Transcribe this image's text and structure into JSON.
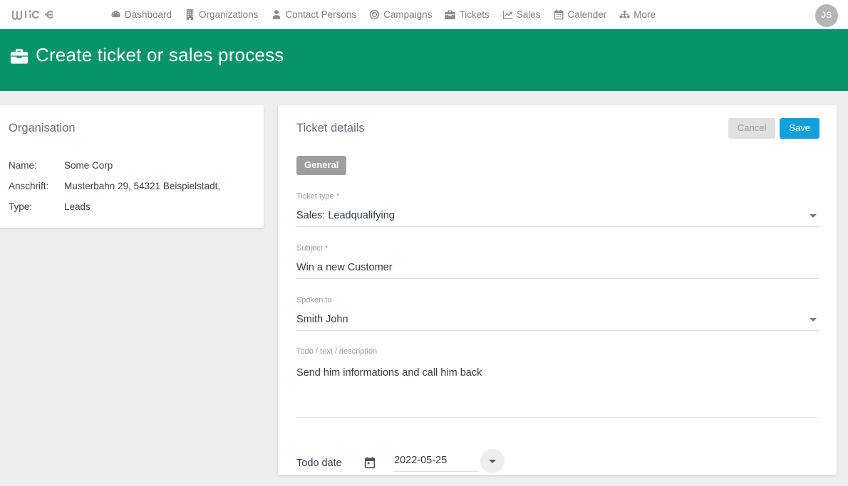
{
  "nav": {
    "brand": "wice",
    "items": [
      {
        "label": "Dashboard",
        "icon": "dashboard-gauge-icon"
      },
      {
        "label": "Organizations",
        "icon": "building-icon"
      },
      {
        "label": "Contact Persons",
        "icon": "person-icon"
      },
      {
        "label": "Campaigns",
        "icon": "target-icon"
      },
      {
        "label": "Tickets",
        "icon": "briefcase-icon"
      },
      {
        "label": "Sales",
        "icon": "chart-line-icon"
      },
      {
        "label": "Calender",
        "icon": "calendar-icon"
      },
      {
        "label": "More",
        "icon": "sitemap-icon"
      }
    ],
    "avatar_initials": "JS"
  },
  "banner": {
    "title": "Create ticket or sales process",
    "icon": "briefcase-icon",
    "color": "#059469"
  },
  "organisation": {
    "title": "Organisation",
    "rows": [
      {
        "label": "Name:",
        "value": "Some Corp"
      },
      {
        "label": "Anschrift:",
        "value": "Musterbahn 29, 54321 Beispielstadt,"
      },
      {
        "label": "Type:",
        "value": "Leads"
      }
    ]
  },
  "ticket": {
    "title": "Ticket details",
    "cancel_label": "Cancel",
    "save_label": "Save",
    "save_color": "#12a0da",
    "tab_label": "General",
    "fields": {
      "ticket_type": {
        "label": "Ticket type *",
        "value": "Sales: Leadqualifying"
      },
      "subject": {
        "label": "Subject *",
        "value": "Win a new Customer"
      },
      "spoken_to": {
        "label": "Spoken to",
        "value": "Smith John"
      },
      "todo_text": {
        "label": "Todo / text / description",
        "value": "Send him informations and call him back"
      },
      "todo_date": {
        "label": "Todo date",
        "value": "2022-05-25"
      }
    }
  }
}
